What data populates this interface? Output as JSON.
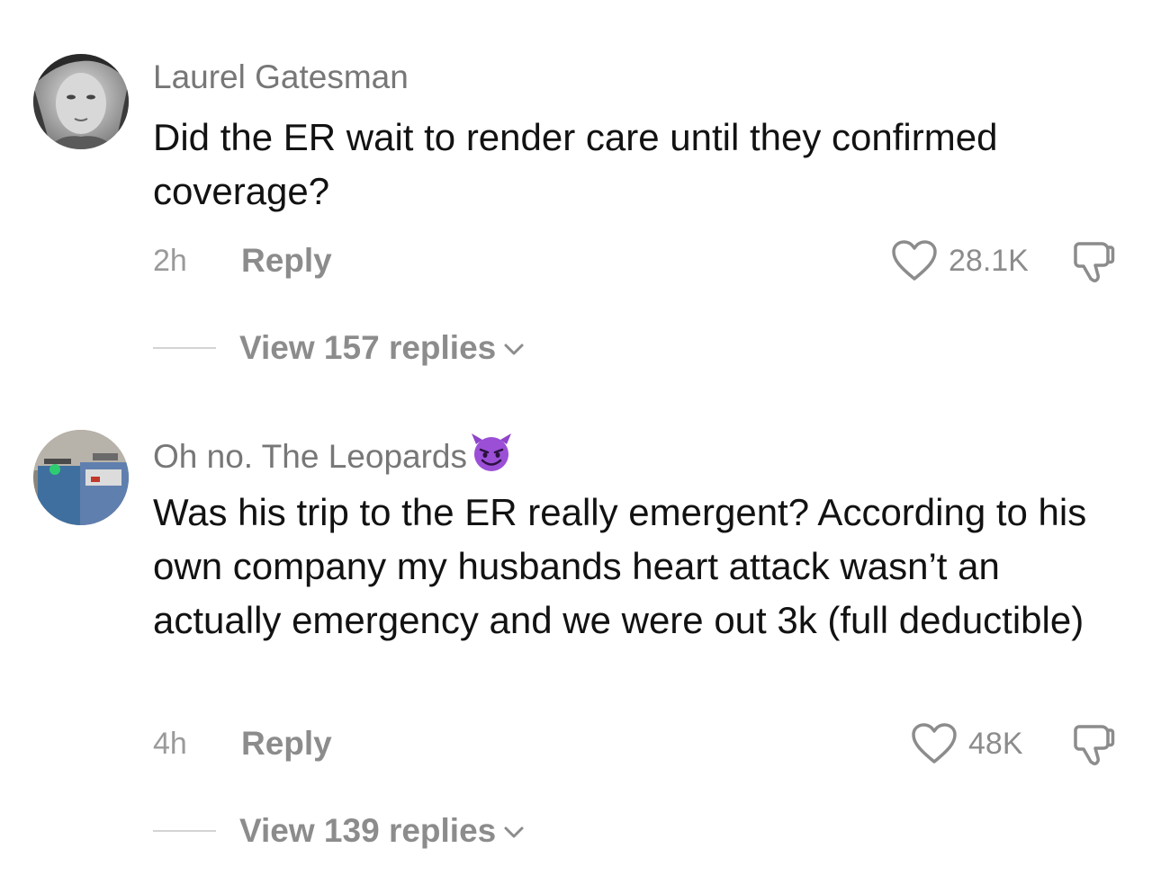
{
  "comments": [
    {
      "username": "Laurel Gatesman",
      "text": "Did the ER wait to render care until they confirmed coverage?",
      "time": "2h",
      "reply_label": "Reply",
      "likes": "28.1K",
      "view_replies": "View 157 replies"
    },
    {
      "username": "Oh no. The Leopards",
      "username_emoji": "smiling-devil-emoji",
      "text": "Was his trip to the ER really emergent? According to his own company my husbands heart attack wasn’t an actually emergency and we were out 3k (full deductible)",
      "time": "4h",
      "reply_label": "Reply",
      "likes": "48K",
      "view_replies": "View 139 replies"
    }
  ],
  "icons": {
    "like": "heart-outline-icon",
    "dislike": "thumbs-down-icon",
    "expand": "chevron-down-icon"
  },
  "colors": {
    "username": "#777777",
    "secondary": "#8c8c8c",
    "emoji_purple": "#9b4fd6"
  }
}
